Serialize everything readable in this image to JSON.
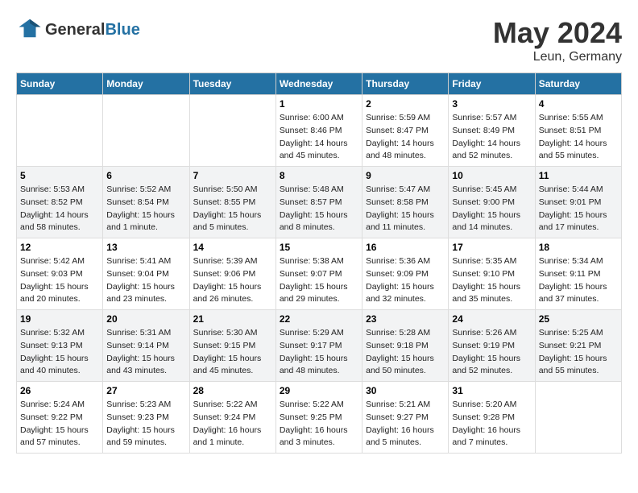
{
  "header": {
    "logo_line1": "General",
    "logo_line2": "Blue",
    "title": "May 2024",
    "subtitle": "Leun, Germany"
  },
  "days_of_week": [
    "Sunday",
    "Monday",
    "Tuesday",
    "Wednesday",
    "Thursday",
    "Friday",
    "Saturday"
  ],
  "weeks": [
    [
      {
        "day": "",
        "info": ""
      },
      {
        "day": "",
        "info": ""
      },
      {
        "day": "",
        "info": ""
      },
      {
        "day": "1",
        "info": "Sunrise: 6:00 AM\nSunset: 8:46 PM\nDaylight: 14 hours\nand 45 minutes."
      },
      {
        "day": "2",
        "info": "Sunrise: 5:59 AM\nSunset: 8:47 PM\nDaylight: 14 hours\nand 48 minutes."
      },
      {
        "day": "3",
        "info": "Sunrise: 5:57 AM\nSunset: 8:49 PM\nDaylight: 14 hours\nand 52 minutes."
      },
      {
        "day": "4",
        "info": "Sunrise: 5:55 AM\nSunset: 8:51 PM\nDaylight: 14 hours\nand 55 minutes."
      }
    ],
    [
      {
        "day": "5",
        "info": "Sunrise: 5:53 AM\nSunset: 8:52 PM\nDaylight: 14 hours\nand 58 minutes."
      },
      {
        "day": "6",
        "info": "Sunrise: 5:52 AM\nSunset: 8:54 PM\nDaylight: 15 hours\nand 1 minute."
      },
      {
        "day": "7",
        "info": "Sunrise: 5:50 AM\nSunset: 8:55 PM\nDaylight: 15 hours\nand 5 minutes."
      },
      {
        "day": "8",
        "info": "Sunrise: 5:48 AM\nSunset: 8:57 PM\nDaylight: 15 hours\nand 8 minutes."
      },
      {
        "day": "9",
        "info": "Sunrise: 5:47 AM\nSunset: 8:58 PM\nDaylight: 15 hours\nand 11 minutes."
      },
      {
        "day": "10",
        "info": "Sunrise: 5:45 AM\nSunset: 9:00 PM\nDaylight: 15 hours\nand 14 minutes."
      },
      {
        "day": "11",
        "info": "Sunrise: 5:44 AM\nSunset: 9:01 PM\nDaylight: 15 hours\nand 17 minutes."
      }
    ],
    [
      {
        "day": "12",
        "info": "Sunrise: 5:42 AM\nSunset: 9:03 PM\nDaylight: 15 hours\nand 20 minutes."
      },
      {
        "day": "13",
        "info": "Sunrise: 5:41 AM\nSunset: 9:04 PM\nDaylight: 15 hours\nand 23 minutes."
      },
      {
        "day": "14",
        "info": "Sunrise: 5:39 AM\nSunset: 9:06 PM\nDaylight: 15 hours\nand 26 minutes."
      },
      {
        "day": "15",
        "info": "Sunrise: 5:38 AM\nSunset: 9:07 PM\nDaylight: 15 hours\nand 29 minutes."
      },
      {
        "day": "16",
        "info": "Sunrise: 5:36 AM\nSunset: 9:09 PM\nDaylight: 15 hours\nand 32 minutes."
      },
      {
        "day": "17",
        "info": "Sunrise: 5:35 AM\nSunset: 9:10 PM\nDaylight: 15 hours\nand 35 minutes."
      },
      {
        "day": "18",
        "info": "Sunrise: 5:34 AM\nSunset: 9:11 PM\nDaylight: 15 hours\nand 37 minutes."
      }
    ],
    [
      {
        "day": "19",
        "info": "Sunrise: 5:32 AM\nSunset: 9:13 PM\nDaylight: 15 hours\nand 40 minutes."
      },
      {
        "day": "20",
        "info": "Sunrise: 5:31 AM\nSunset: 9:14 PM\nDaylight: 15 hours\nand 43 minutes."
      },
      {
        "day": "21",
        "info": "Sunrise: 5:30 AM\nSunset: 9:15 PM\nDaylight: 15 hours\nand 45 minutes."
      },
      {
        "day": "22",
        "info": "Sunrise: 5:29 AM\nSunset: 9:17 PM\nDaylight: 15 hours\nand 48 minutes."
      },
      {
        "day": "23",
        "info": "Sunrise: 5:28 AM\nSunset: 9:18 PM\nDaylight: 15 hours\nand 50 minutes."
      },
      {
        "day": "24",
        "info": "Sunrise: 5:26 AM\nSunset: 9:19 PM\nDaylight: 15 hours\nand 52 minutes."
      },
      {
        "day": "25",
        "info": "Sunrise: 5:25 AM\nSunset: 9:21 PM\nDaylight: 15 hours\nand 55 minutes."
      }
    ],
    [
      {
        "day": "26",
        "info": "Sunrise: 5:24 AM\nSunset: 9:22 PM\nDaylight: 15 hours\nand 57 minutes."
      },
      {
        "day": "27",
        "info": "Sunrise: 5:23 AM\nSunset: 9:23 PM\nDaylight: 15 hours\nand 59 minutes."
      },
      {
        "day": "28",
        "info": "Sunrise: 5:22 AM\nSunset: 9:24 PM\nDaylight: 16 hours\nand 1 minute."
      },
      {
        "day": "29",
        "info": "Sunrise: 5:22 AM\nSunset: 9:25 PM\nDaylight: 16 hours\nand 3 minutes."
      },
      {
        "day": "30",
        "info": "Sunrise: 5:21 AM\nSunset: 9:27 PM\nDaylight: 16 hours\nand 5 minutes."
      },
      {
        "day": "31",
        "info": "Sunrise: 5:20 AM\nSunset: 9:28 PM\nDaylight: 16 hours\nand 7 minutes."
      },
      {
        "day": "",
        "info": ""
      }
    ]
  ]
}
